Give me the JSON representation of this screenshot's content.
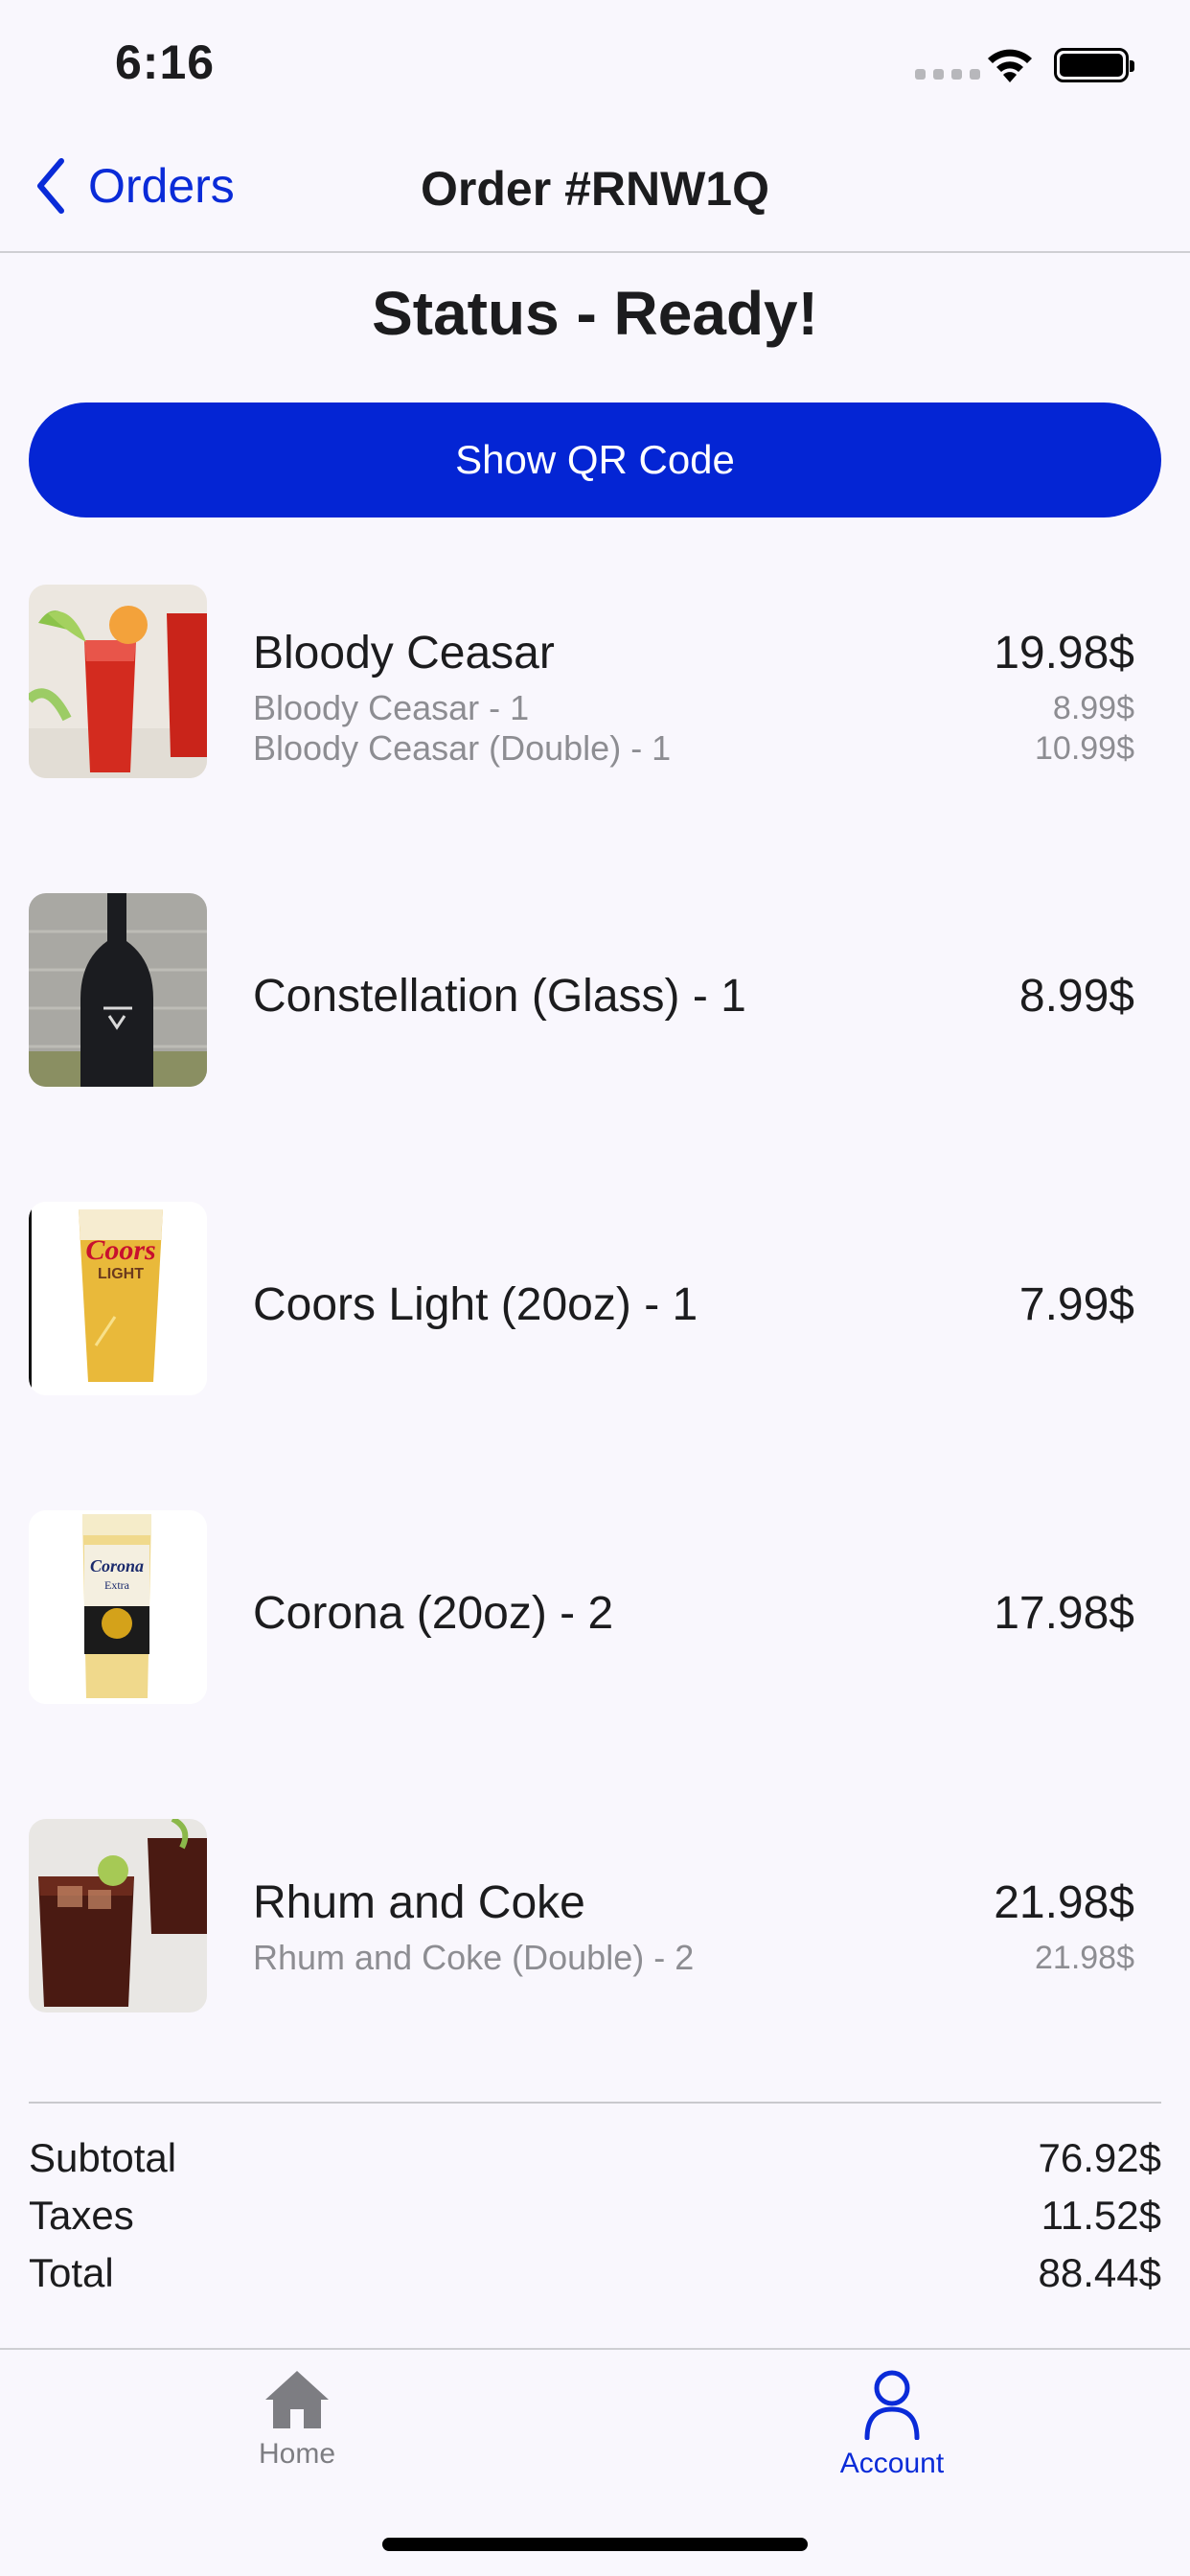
{
  "status_bar": {
    "time": "6:16"
  },
  "nav": {
    "back_label": "Orders",
    "title": "Order #RNW1Q"
  },
  "status_title": "Status - Ready!",
  "qr_button": "Show QR Code",
  "items": [
    {
      "title": "Bloody Ceasar",
      "price": "19.98$",
      "image": "bloody-caesar-photo",
      "details": [
        {
          "label": "Bloody Ceasar - 1",
          "price": "8.99$"
        },
        {
          "label": "Bloody Ceasar (Double) - 1",
          "price": "10.99$"
        }
      ]
    },
    {
      "title": "Constellation (Glass) - 1",
      "price": "8.99$",
      "image": "wine-bottle-photo",
      "details": []
    },
    {
      "title": "Coors Light (20oz) - 1",
      "price": "7.99$",
      "image": "coors-light-glass-photo",
      "details": []
    },
    {
      "title": "Corona (20oz) - 2",
      "price": "17.98$",
      "image": "corona-glass-photo",
      "details": []
    },
    {
      "title": "Rhum and Coke",
      "price": "21.98$",
      "image": "rum-and-coke-photo",
      "details": [
        {
          "label": "Rhum and Coke (Double) - 2",
          "price": "21.98$"
        }
      ]
    }
  ],
  "totals": {
    "subtotal_label": "Subtotal",
    "subtotal": "76.92$",
    "taxes_label": "Taxes",
    "taxes": "11.52$",
    "total_label": "Total",
    "total": "88.44$"
  },
  "tabbar": {
    "home_label": "Home",
    "account_label": "Account"
  },
  "colors": {
    "accent": "#0425d4",
    "muted": "#8d8d92",
    "background": "#f9f7fd"
  }
}
